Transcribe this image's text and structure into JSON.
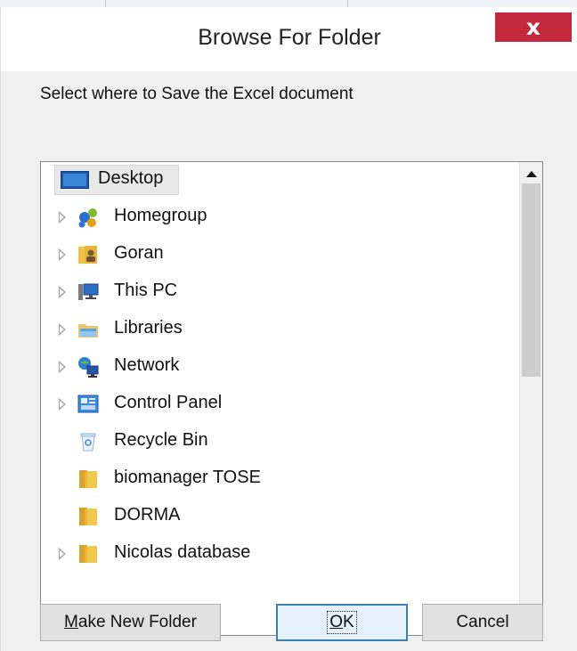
{
  "dialog": {
    "title": "Browse For Folder",
    "close_glyph": "x",
    "prompt": "Select where to Save the Excel document"
  },
  "tree": {
    "items": [
      {
        "label": "Desktop",
        "icon": "desktop-icon",
        "expandable": false,
        "selected": true
      },
      {
        "label": "Homegroup",
        "icon": "homegroup-icon",
        "expandable": true
      },
      {
        "label": "Goran",
        "icon": "user-folder-icon",
        "expandable": true
      },
      {
        "label": "This PC",
        "icon": "computer-icon",
        "expandable": true
      },
      {
        "label": "Libraries",
        "icon": "libraries-icon",
        "expandable": true
      },
      {
        "label": "Network",
        "icon": "network-icon",
        "expandable": true
      },
      {
        "label": "Control Panel",
        "icon": "control-panel-icon",
        "expandable": true
      },
      {
        "label": "Recycle Bin",
        "icon": "recycle-bin-icon",
        "expandable": false
      },
      {
        "label": "biomanager TOSE",
        "icon": "folder-icon",
        "expandable": false
      },
      {
        "label": "DORMA",
        "icon": "folder-icon",
        "expandable": false
      },
      {
        "label": "Nicolas database",
        "icon": "folder-icon",
        "expandable": true
      }
    ],
    "scroll_position": 0.0,
    "scroll_visible_fraction": 0.45
  },
  "buttons": {
    "make_new_folder_first": "M",
    "make_new_folder_rest": "ake New Folder",
    "ok_first": "O",
    "ok_rest": "K",
    "cancel": "Cancel"
  },
  "colors": {
    "close_button": "#c5283c",
    "default_button_border": "#3c7fb1",
    "selection_background": "#e9e9e9"
  }
}
